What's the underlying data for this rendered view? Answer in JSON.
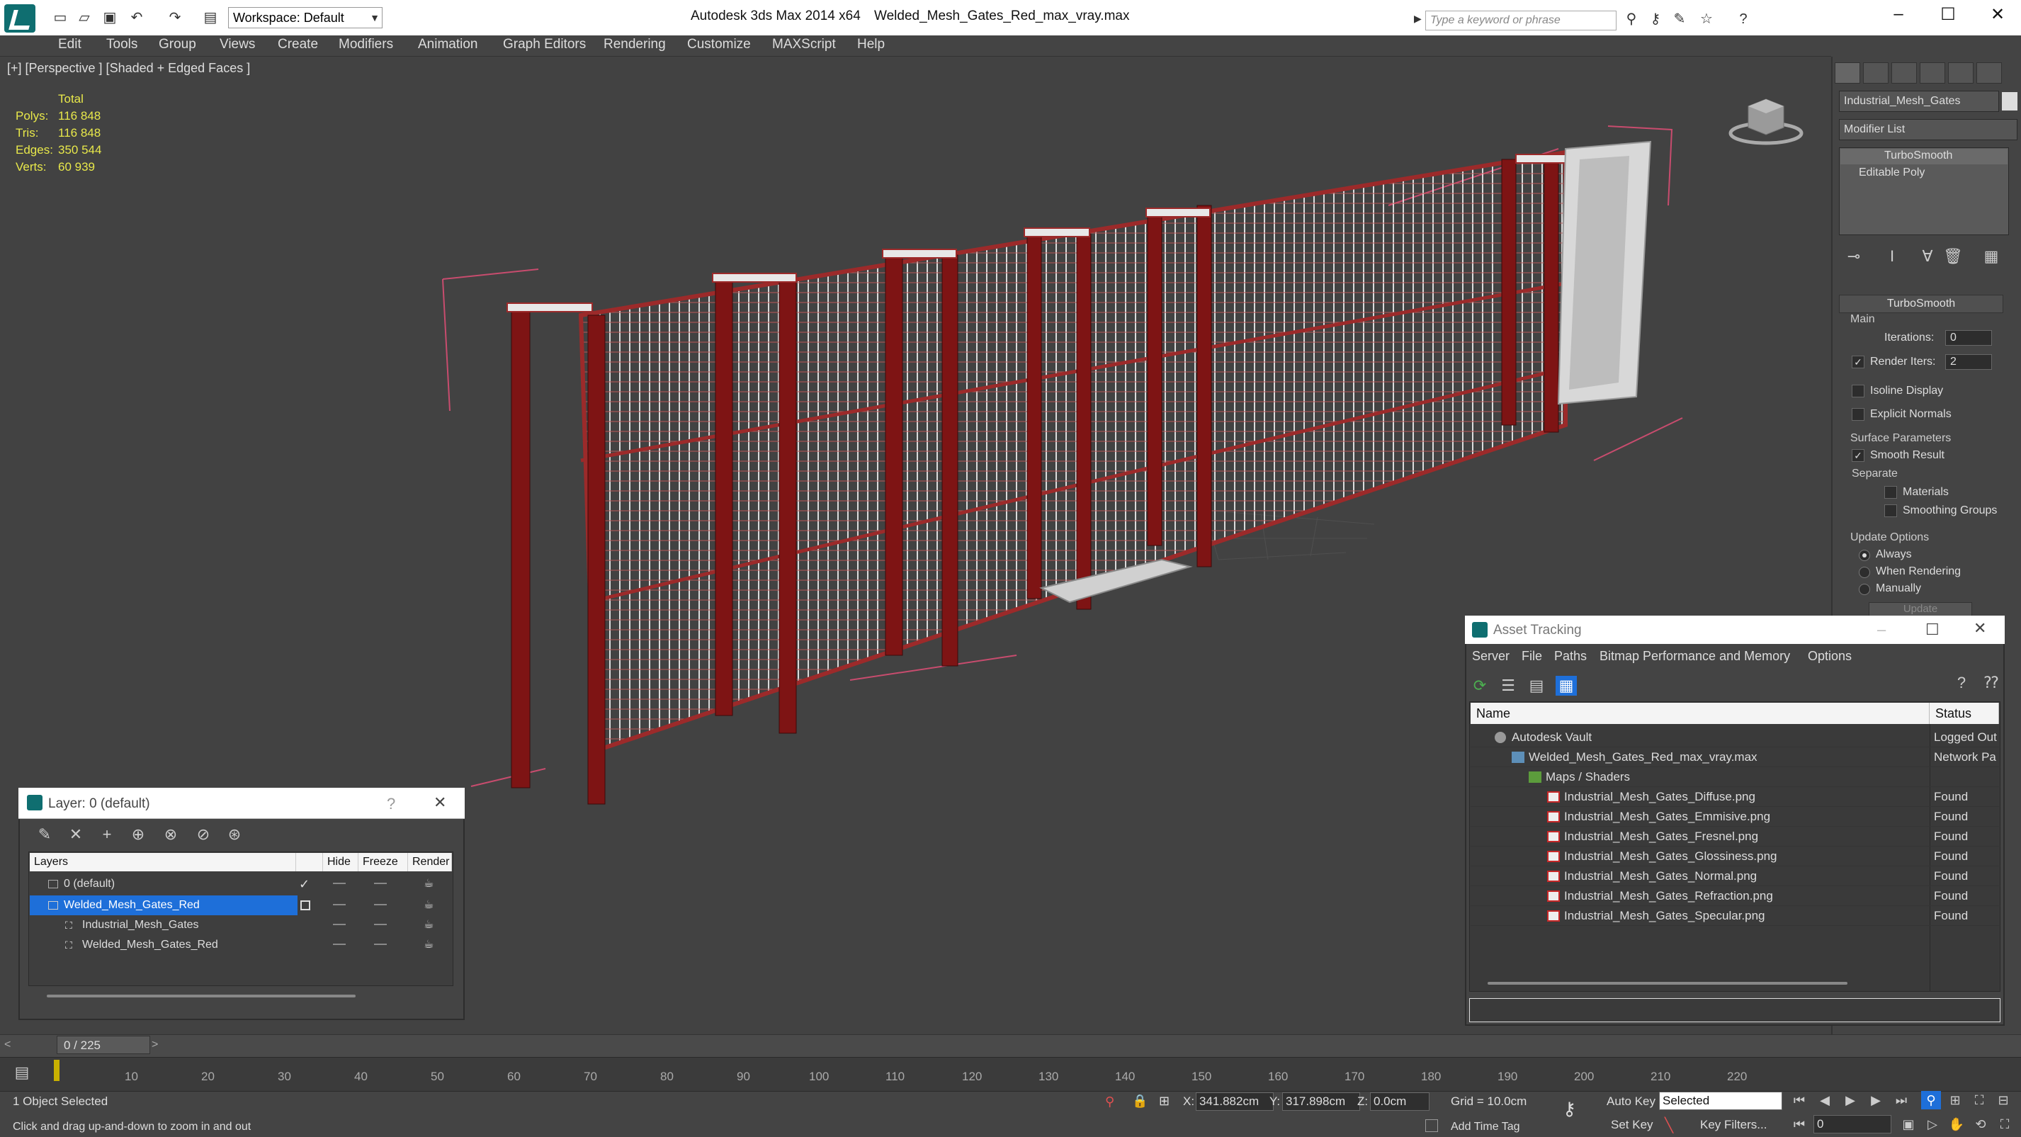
{
  "titlebar": {
    "workspace": "Workspace: Default",
    "app_title": "Autodesk 3ds Max  2014 x64",
    "file_title": "Welded_Mesh_Gates_Red_max_vray.max",
    "search_placeholder": "Type a keyword or phrase"
  },
  "menu": [
    "Edit",
    "Tools",
    "Group",
    "Views",
    "Create",
    "Modifiers",
    "Animation",
    "Graph Editors",
    "Rendering",
    "Customize",
    "MAXScript",
    "Help"
  ],
  "viewport": {
    "label": "[+] [Perspective ] [Shaded + Edged Faces ]",
    "stats_header": "Total",
    "stats": [
      {
        "label": "Polys:",
        "value": "116 848"
      },
      {
        "label": "Tris:",
        "value": "116 848"
      },
      {
        "label": "Edges:",
        "value": "350 544"
      },
      {
        "label": "Verts:",
        "value": "60 939"
      }
    ]
  },
  "command_panel": {
    "object_name": "Industrial_Mesh_Gates",
    "modifier_list": "Modifier List",
    "stack": [
      "TurboSmooth",
      "Editable Poly"
    ],
    "rollout_title": "TurboSmooth",
    "main_label": "Main",
    "iterations_label": "Iterations:",
    "iterations_value": "0",
    "render_iters_label": "Render Iters:",
    "render_iters_value": "2",
    "isoline_label": "Isoline Display",
    "explicit_normals_label": "Explicit Normals",
    "surface_params_label": "Surface Parameters",
    "smooth_result_label": "Smooth Result",
    "separate_label": "Separate",
    "materials_label": "Materials",
    "smoothing_groups_label": "Smoothing Groups",
    "update_options_label": "Update Options",
    "always_label": "Always",
    "when_rendering_label": "When Rendering",
    "manually_label": "Manually",
    "update_label": "Update"
  },
  "layer_dialog": {
    "title": "Layer: 0 (default)",
    "help": "?",
    "headers": [
      "Layers",
      "Hide",
      "Freeze",
      "Render"
    ],
    "rows": [
      {
        "name": "0 (default)"
      },
      {
        "name": "Welded_Mesh_Gates_Red"
      },
      {
        "name": "Industrial_Mesh_Gates"
      },
      {
        "name": "Welded_Mesh_Gates_Red"
      }
    ]
  },
  "asset_dialog": {
    "title": "Asset Tracking",
    "menu": [
      "Server",
      "File",
      "Paths",
      "Bitmap Performance and Memory",
      "Options"
    ],
    "headers": [
      "Name",
      "Status"
    ],
    "rows": [
      {
        "name": "Autodesk Vault",
        "status": "Logged Out"
      },
      {
        "name": "Welded_Mesh_Gates_Red_max_vray.max",
        "status": "Network Pa"
      },
      {
        "name": "Maps / Shaders",
        "status": ""
      },
      {
        "name": "Industrial_Mesh_Gates_Diffuse.png",
        "status": "Found"
      },
      {
        "name": "Industrial_Mesh_Gates_Emmisive.png",
        "status": "Found"
      },
      {
        "name": "Industrial_Mesh_Gates_Fresnel.png",
        "status": "Found"
      },
      {
        "name": "Industrial_Mesh_Gates_Glossiness.png",
        "status": "Found"
      },
      {
        "name": "Industrial_Mesh_Gates_Normal.png",
        "status": "Found"
      },
      {
        "name": "Industrial_Mesh_Gates_Refraction.png",
        "status": "Found"
      },
      {
        "name": "Industrial_Mesh_Gates_Specular.png",
        "status": "Found"
      }
    ]
  },
  "timeline": {
    "frame": "0 / 225",
    "ticks": [
      "10",
      "20",
      "30",
      "40",
      "50",
      "60",
      "70",
      "80",
      "90",
      "100",
      "110",
      "120",
      "130",
      "140",
      "150",
      "160",
      "170",
      "180",
      "190",
      "200",
      "210",
      "220"
    ]
  },
  "status": {
    "selection": "1 Object Selected",
    "prompt": "Click and drag up-and-down to zoom in and out",
    "x_label": "X:",
    "x_value": "341.882cm",
    "y_label": "Y:",
    "y_value": "317.898cm",
    "z_label": "Z:",
    "z_value": "0.0cm",
    "grid": "Grid = 10.0cm",
    "auto_key": "Auto Key",
    "selected": "Selected",
    "set_key": "Set Key",
    "key_filters": "Key Filters...",
    "add_time_tag": "Add Time Tag",
    "frame_field": "0"
  },
  "colors": {
    "accent_blue": "#1e6fd9",
    "stat_yellow": "#e8e84a",
    "wire_red": "#8b1d1d"
  }
}
